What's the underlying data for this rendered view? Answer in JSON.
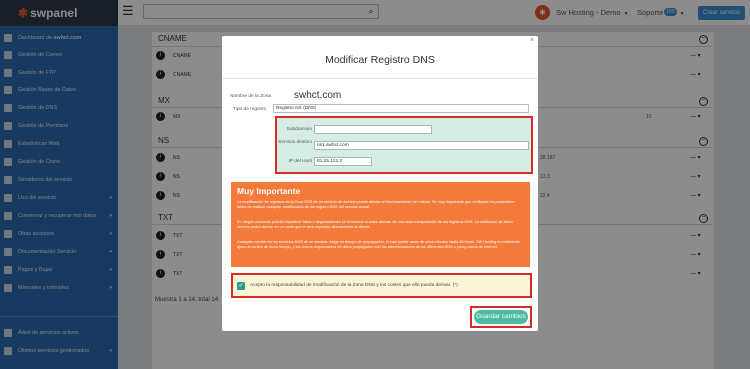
{
  "brand": {
    "logo_text": "swpanel",
    "logo_mark": "✱"
  },
  "topbar": {
    "user_name": "Sw Hosting - Demo",
    "support_label": "Soporte",
    "support_badge": "100",
    "create_service_label": "Crear servicio"
  },
  "sidebar": {
    "items": [
      {
        "label": "Dashboard de ",
        "bold": "swhct.com",
        "icon": "dashboard-icon"
      },
      {
        "label": "Gestión de Correo",
        "icon": "mail-icon"
      },
      {
        "label": "Gestión de FTP",
        "icon": "ftp-icon"
      },
      {
        "label": "Gestión Bases de Datos",
        "icon": "database-icon"
      },
      {
        "label": "Gestión de DNS",
        "icon": "dns-icon"
      },
      {
        "label": "Gestión de Permisos",
        "icon": "permissions-icon"
      },
      {
        "label": "Estadísticas Web",
        "icon": "stats-icon"
      },
      {
        "label": "Gestión de Crons",
        "icon": "clock-icon"
      },
      {
        "label": "Servidores del servicio",
        "icon": "server-icon"
      },
      {
        "label": "Uso del servicio",
        "icon": "usage-icon"
      },
      {
        "label": "Conservar y recuperar mis datos",
        "icon": "backup-icon"
      },
      {
        "label": "Otras acciones",
        "icon": "actions-icon"
      },
      {
        "label": "Documentación Servicio",
        "icon": "docs-icon"
      },
      {
        "label": "Pagos y Bajas",
        "icon": "payments-icon"
      },
      {
        "label": "Manuales y tutoriales",
        "icon": "help-icon"
      },
      {
        "label": "Árbol de servicios activos",
        "icon": "tree-icon"
      },
      {
        "label": "Últimos servicios gestionados",
        "icon": "recent-icon"
      }
    ]
  },
  "background": {
    "sections": [
      {
        "title": "CNAME",
        "rows": [
          "CNAME",
          "CNAME"
        ]
      },
      {
        "title": "MX",
        "rows": [
          "MX"
        ]
      },
      {
        "title": "NS",
        "rows": [
          "NS",
          "NS",
          "NS"
        ]
      },
      {
        "title": "TXT",
        "rows": [
          "TXT",
          "TXT",
          "TXT"
        ]
      }
    ],
    "extras": [
      "10",
      "28.187",
      "12.3",
      "12.4"
    ],
    "row_menu": "— ▾",
    "pager": "Muestra 1 a 14, total 14"
  },
  "modal": {
    "title": "Modificar Registro DNS",
    "close": "×",
    "zone_label": "Nombre de la Zona",
    "zone_value": "swhct.com",
    "type_label": "Tipo de registro",
    "type_value": "Registro NS (DNS)",
    "subdomain_label": "Subdominio",
    "subdomain_value": "",
    "service_label": "Servicio destino",
    "service_value": "ns1.swhct.com",
    "ip_label": "IP del Host",
    "ip_value": "81.25.112.3",
    "warning": {
      "title": "Muy Importante",
      "p1": "La modificación de registros de la Zona DNS de un servicio de dominio puede afectar al funcionamiento del mismo. Se muy importante que verifiques los parámetros antes de realizar cualquier modificación de los registro DNS del servicio actual.",
      "p2": "En ningún momento podrán imputarse fallos o degradaciones en el servicio si estos derivan de una mala manipulación de los registros DNS. La restitución de dicho servicio podrá derivar en un coste que le será imputado directamente al cliente.",
      "p3": "Cualquier cambio en los servicios DNS de un dominio, exige un tiempo de propagación, el cual puede variar de unos minutos hasta 48 horas. SW Hosting es totalmente ajeno al control de dicho tiempo, y los únicos responsables de dicha propagación son los administradores de los diferentes DNS o proxy-caché de Internet."
    },
    "accept_text": "Acepto la responsabilidad de modificación de la Zona DNS y los costes que ello pueda derivar. (*)",
    "accept_checked": true,
    "save_label": "Guardar cambios"
  },
  "colors": {
    "sidebar": "#2d6bb1",
    "brand_accent": "#e8572a",
    "primary_button": "#3b8ed6",
    "warning_bg": "#f47a3c",
    "highlight_border": "#d92a2a",
    "save_button": "#4dbb9f",
    "dns_box_bg": "#d5ede5"
  }
}
